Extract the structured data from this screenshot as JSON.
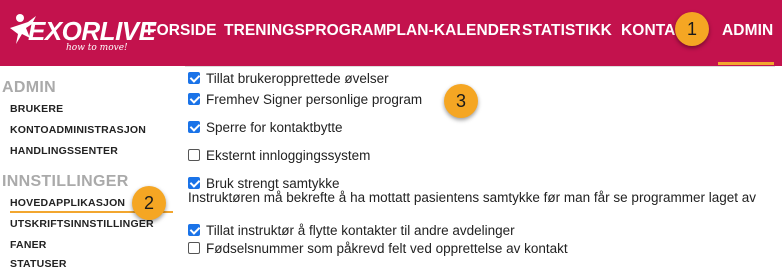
{
  "brand": {
    "name": "EXORLIVE",
    "tagline": "how to move!"
  },
  "nav": {
    "items": [
      "FORSIDE",
      "TRENINGSPROGRAM",
      "PLAN-KALENDER",
      "STATISTIKK",
      "KONTAKTER",
      "ADMIN"
    ],
    "active": "ADMIN"
  },
  "badges": [
    "1",
    "2",
    "3"
  ],
  "sidebar": {
    "admin_heading": "ADMIN",
    "admin_items": [
      "BRUKERE",
      "KONTOADMINISTRASJON",
      "HANDLINGSSENTER"
    ],
    "settings_heading": "INNSTILLINGER",
    "settings_items": [
      "HOVEDAPPLIKASJON",
      "UTSKRIFTSINNSTILLINGER",
      "FANER",
      "STATUSER"
    ],
    "active_item": "HOVEDAPPLIKASJON"
  },
  "options": [
    {
      "label": "Tillat brukeropprettede øvelser",
      "checked": true
    },
    {
      "label": "Fremhev Signer personlige program",
      "checked": true
    },
    {
      "label": "Sperre for kontaktbytte",
      "checked": true
    },
    {
      "label": "Eksternt innloggingssystem",
      "checked": false
    },
    {
      "label": "Bruk strengt samtykke",
      "checked": true,
      "description": "Instruktøren må bekrefte å ha mottatt pasientens samtykke før man får se programmer laget av"
    },
    {
      "label": "Tillat instruktør å flytte kontakter til andre avdelinger",
      "checked": true
    },
    {
      "label": "Fødselsnummer som påkrevd felt ved opprettelse av kontakt",
      "checked": false
    }
  ],
  "colors": {
    "brand": "#c3124d",
    "accent": "#f2a62f",
    "badge": "#f5a623",
    "checkbox": "#1a73e8"
  }
}
